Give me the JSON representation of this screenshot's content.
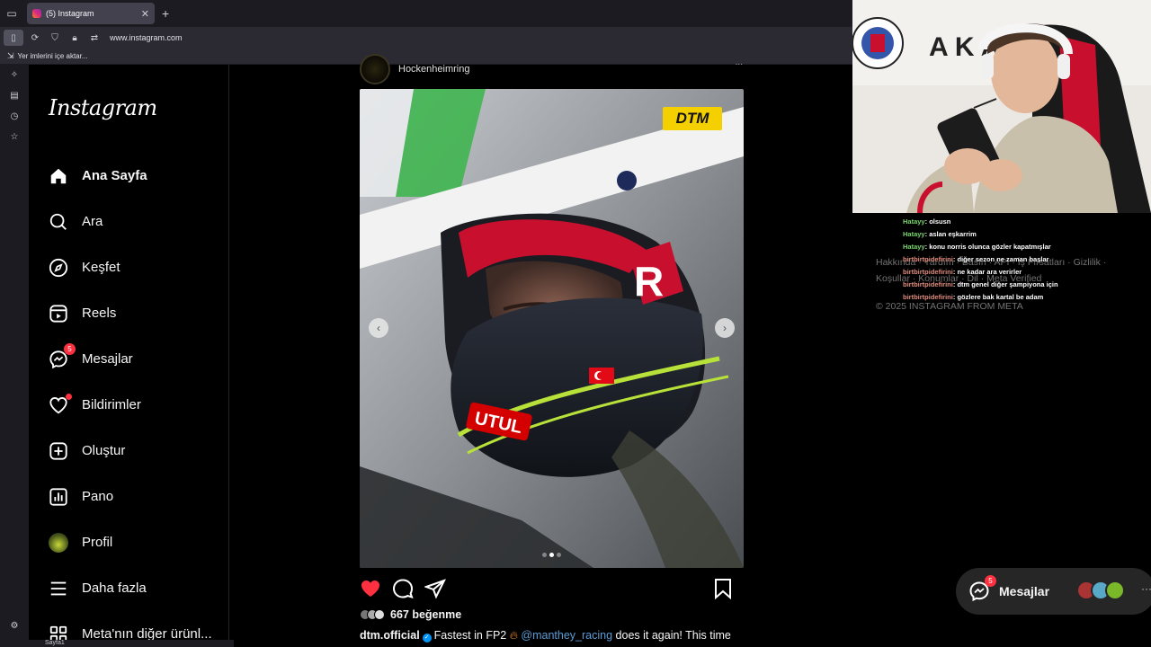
{
  "browser": {
    "tab_title": "(5) Instagram",
    "url": "www.instagram.com",
    "bookmark_import": "Yer imlerini içe aktar...",
    "bottom_tab": "Sayfa1"
  },
  "sidebar": {
    "logo": "Instagram",
    "items": [
      {
        "label": "Ana Sayfa",
        "icon": "home-icon"
      },
      {
        "label": "Ara",
        "icon": "search-icon"
      },
      {
        "label": "Keşfet",
        "icon": "compass-icon"
      },
      {
        "label": "Reels",
        "icon": "reels-icon"
      },
      {
        "label": "Mesajlar",
        "icon": "messenger-icon",
        "badge": "5"
      },
      {
        "label": "Bildirimler",
        "icon": "heart-icon"
      },
      {
        "label": "Oluştur",
        "icon": "plus-square-icon"
      },
      {
        "label": "Pano",
        "icon": "dashboard-icon"
      },
      {
        "label": "Profil",
        "icon": "avatar"
      },
      {
        "label": "Daha fazla",
        "icon": "menu-icon"
      },
      {
        "label": "Meta'nın diğer ürünl...",
        "icon": "apps-icon"
      }
    ]
  },
  "post": {
    "location": "Hockenheimring",
    "more": "...",
    "image_badge": "DTM",
    "likes": "667 beğenme",
    "caption_user": "dtm.official",
    "caption_text_1": "Fastest in FP2",
    "caption_mention": "@manthey_racing",
    "caption_text_2": "does it again! This time"
  },
  "footer": {
    "links_1": "Hakkında · Yardım · Basın · API · İş Fırsatları · Gizlilik ·",
    "links_2": "Koşullar · Konumlar · Dil · Meta Verified",
    "copyright": "© 2025 INSTAGRAM FROM META"
  },
  "chat": [
    {
      "user": "Hatayy",
      "msg": "olsusn",
      "color": "#7ad46f"
    },
    {
      "user": "Hatayy",
      "msg": "aslan eşkarrim",
      "color": "#7ad46f"
    },
    {
      "user": "Hatayy",
      "msg": "konu norris olunca gözler kapatmışlar",
      "color": "#7ad46f"
    },
    {
      "user": "birtbirtpidefirini",
      "msg": "diğer sezon ne zaman başlar",
      "color": "#e08b7c"
    },
    {
      "user": "birtbirtpidefirini",
      "msg": "ne kadar ara verirler",
      "color": "#e08b7c"
    },
    {
      "user": "birtbirtpidefirini",
      "msg": "dtm genel diğer şampiyona için",
      "color": "#e08b7c"
    },
    {
      "user": "birtbirtpidefirini",
      "msg": "gözlere bak kartal be adam",
      "color": "#e08b7c"
    }
  ],
  "messages_pill": {
    "label": "Mesajlar",
    "badge": "5",
    "more": "···"
  },
  "colors": {
    "accent_red": "#ff3040",
    "like_red": "#ff3040",
    "verified_blue": "#0095f6",
    "dtm_yellow": "#f5d000"
  }
}
